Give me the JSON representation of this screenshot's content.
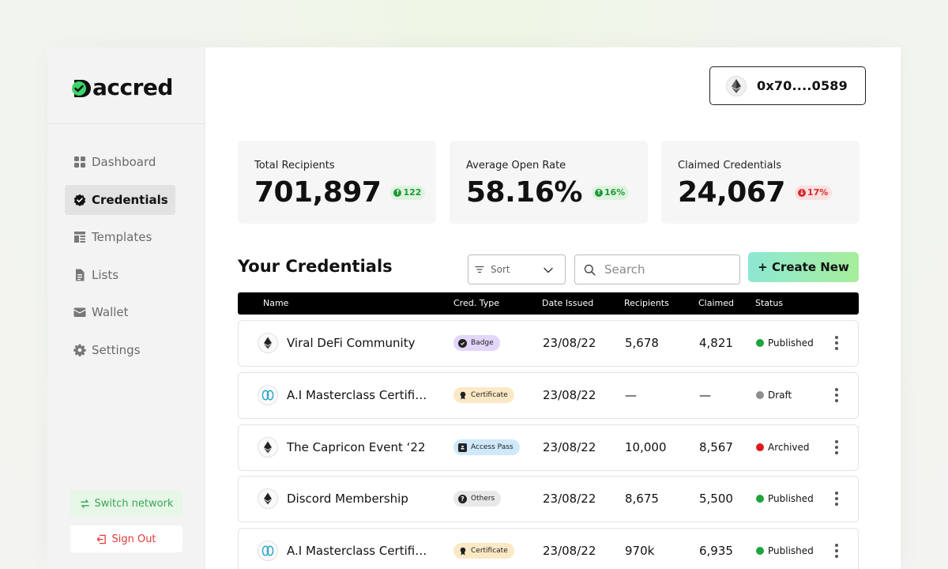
{
  "brand": {
    "name": "accred",
    "accent": "#3dd36b"
  },
  "sidebar": {
    "items": [
      {
        "label": "Dashboard",
        "icon": "dashboard-icon",
        "active": false
      },
      {
        "label": "Credentials",
        "icon": "credentials-icon",
        "active": true
      },
      {
        "label": "Templates",
        "icon": "templates-icon",
        "active": false
      },
      {
        "label": "Lists",
        "icon": "lists-icon",
        "active": false
      },
      {
        "label": "Wallet",
        "icon": "wallet-icon",
        "active": false
      },
      {
        "label": "Settings",
        "icon": "gear-icon",
        "active": false
      }
    ],
    "switch_network": "Switch network",
    "sign_out": "Sign Out"
  },
  "header": {
    "wallet_address": "0x70....0589"
  },
  "stats": [
    {
      "label": "Total Recipients",
      "value": "701,897",
      "delta": "122",
      "trend": "up"
    },
    {
      "label": "Average Open Rate",
      "value": "58.16%",
      "delta": "16%",
      "trend": "up"
    },
    {
      "label": "Claimed Credentials",
      "value": "24,067",
      "delta": "17%",
      "trend": "down"
    }
  ],
  "credentials": {
    "title": "Your Credentials",
    "sort_placeholder": "Sort",
    "search_placeholder": "Search",
    "create_label": "+ Create New",
    "columns": [
      "Name",
      "Cred. Type",
      "Date Issued",
      "Recipients",
      "Claimed",
      "Status"
    ],
    "rows": [
      {
        "icon": "ethereum-icon",
        "name": "Viral DeFi Community",
        "type": "Badge",
        "type_color": "#e2d6fb",
        "date": "23/08/22",
        "recipients": "5,678",
        "claimed": "4,821",
        "status": "Published",
        "status_color": "#1fa33d"
      },
      {
        "icon": "hedera-icon",
        "name": "A.I Masterclass Certifi…",
        "type": "Certificate",
        "type_color": "#fbe9c6",
        "date": "23/08/22",
        "recipients": "—",
        "claimed": "—",
        "status": "Draft",
        "status_color": "#8e8e8e"
      },
      {
        "icon": "ethereum-icon",
        "name": "The Capricon Event ‘22",
        "type": "Access Pass",
        "type_color": "#cfe8fb",
        "date": "23/08/22",
        "recipients": "10,000",
        "claimed": "8,567",
        "status": "Archived",
        "status_color": "#e01919"
      },
      {
        "icon": "ethereum-icon",
        "name": "Discord Membership",
        "type": "Others",
        "type_color": "#e8e8e8",
        "date": "23/08/22",
        "recipients": "8,675",
        "claimed": "5,500",
        "status": "Published",
        "status_color": "#1fa33d"
      },
      {
        "icon": "hedera-icon",
        "name": "A.I Masterclass Certifi…",
        "type": "Certificate",
        "type_color": "#fbe9c6",
        "date": "23/08/22",
        "recipients": "970k",
        "claimed": "6,935",
        "status": "Published",
        "status_color": "#1fa33d"
      }
    ]
  }
}
